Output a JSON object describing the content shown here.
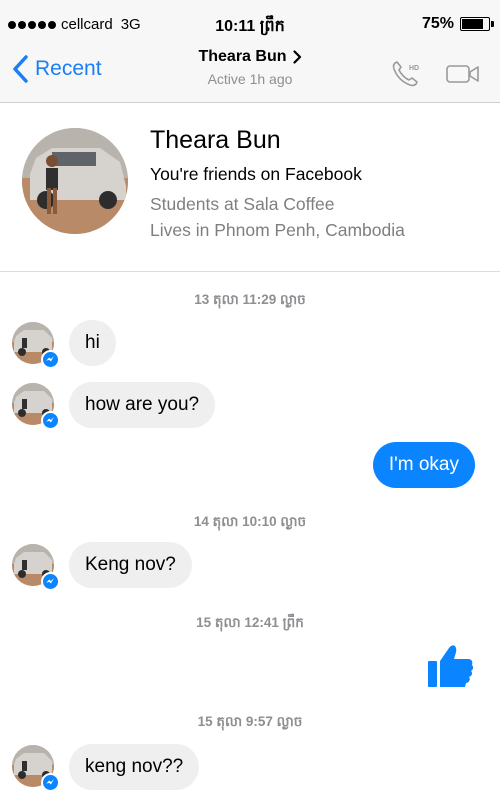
{
  "status_bar": {
    "carrier": "cellcard",
    "network": "3G",
    "time": "10:11 ព្រឹក",
    "battery_text": "75%",
    "battery_level": 0.75
  },
  "nav": {
    "back_label": "Recent",
    "contact_name": "Theara Bun",
    "active_status": "Active 1h ago",
    "call_badge": "HD"
  },
  "profile": {
    "name": "Theara Bun",
    "friends": "You're friends on Facebook",
    "work": "Students at Sala Coffee",
    "lives": "Lives in Phnom Penh, Cambodia"
  },
  "messages": {
    "ts1": "13 តុលា 11:29 ល្ងាច",
    "m1": "hi",
    "m2": "how are you?",
    "m3": "I'm okay",
    "ts2": "14 តុលា 10:10 ល្ងាច",
    "m4": "Keng nov?",
    "ts3": "15 តុលា 12:41 ព្រឹក",
    "ts4": "15 តុលា 9:57 ល្ងាច",
    "m5": "keng nov??"
  },
  "icons": {
    "back": "chevron-left-icon",
    "call": "phone-hd-icon",
    "video": "video-camera-icon",
    "like": "thumbs-up-icon",
    "badge": "messenger-icon"
  },
  "colors": {
    "accent": "#0a84ff",
    "incoming_bubble": "#efefef",
    "secondary_text": "#8e8e93"
  }
}
